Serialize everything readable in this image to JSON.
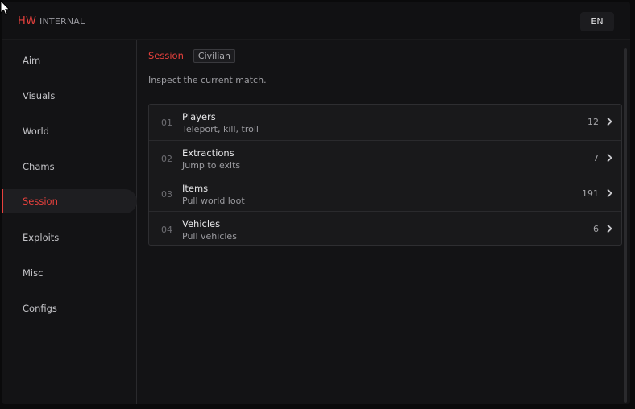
{
  "brand": {
    "hw": "HW",
    "internal": "INTERNAL"
  },
  "language": "EN",
  "sidebar": {
    "items": [
      {
        "label": "Aim"
      },
      {
        "label": "Visuals"
      },
      {
        "label": "World"
      },
      {
        "label": "Chams"
      },
      {
        "label": "Session",
        "active": true
      },
      {
        "label": "Exploits"
      },
      {
        "label": "Misc"
      },
      {
        "label": "Configs"
      }
    ]
  },
  "main": {
    "breadcrumb": {
      "current": "Session",
      "badge": "Civilian"
    },
    "description": "Inspect the current match.",
    "rows": [
      {
        "num": "01",
        "name": "Players",
        "sub": "Teleport, kill, troll",
        "count": "12"
      },
      {
        "num": "02",
        "name": "Extractions",
        "sub": "Jump to exits",
        "count": "7"
      },
      {
        "num": "03",
        "name": "Items",
        "sub": "Pull world loot",
        "count": "191"
      },
      {
        "num": "04",
        "name": "Vehicles",
        "sub": "Pull vehicles",
        "count": "6"
      }
    ]
  },
  "colors": {
    "accent": "#e8413d",
    "background": "#131315",
    "panel": "#19191b"
  },
  "icons": {
    "row_chevron": "chevron-right-icon",
    "cursor": "mouse-pointer-icon"
  }
}
